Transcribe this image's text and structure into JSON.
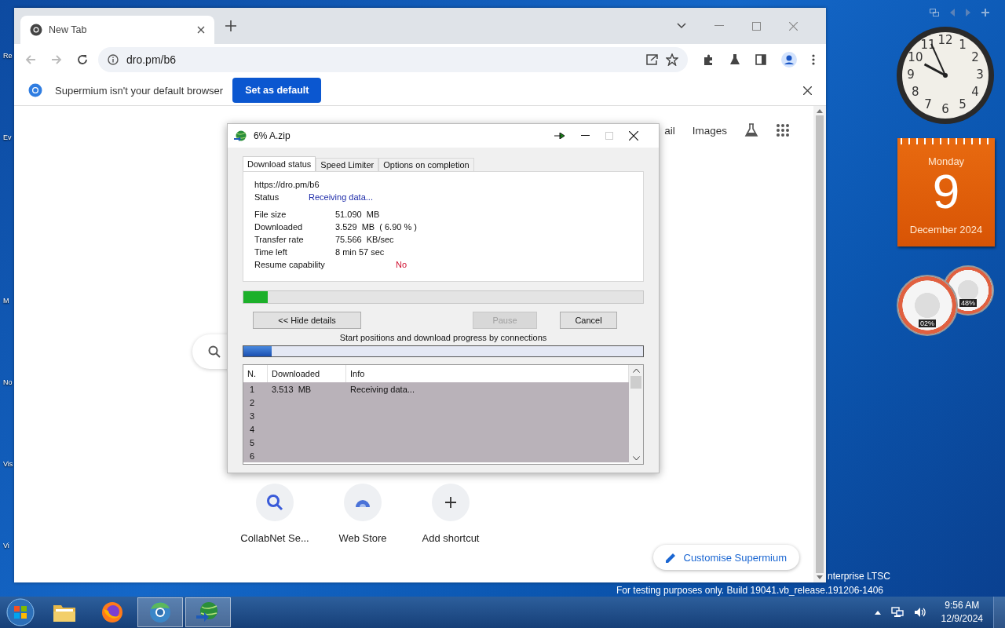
{
  "desktop": {
    "icon_labels": [
      "Re",
      "Ev",
      "M",
      "No",
      "Vis",
      "Vi"
    ],
    "watermark": [
      "nterprise LTSC",
      "For testing purposes only. Build 19041.vb_release.191206-1406"
    ]
  },
  "browser": {
    "tabs": [
      {
        "title": "New Tab",
        "selected": true
      }
    ],
    "address": "dro.pm/b6",
    "infobar": {
      "message": "Supermium isn't your default browser",
      "button": "Set as default"
    },
    "page": {
      "top_links": [
        "ail",
        "Images"
      ],
      "shortcuts": [
        {
          "label": "CollabNet Se...",
          "kind": "search"
        },
        {
          "label": "Web Store",
          "kind": "store"
        },
        {
          "label": "Add shortcut",
          "kind": "add"
        }
      ],
      "customise": "Customise Supermium"
    }
  },
  "download_dialog": {
    "title": "6% A.zip",
    "tabs": [
      {
        "label": "Download status",
        "selected": true
      },
      {
        "label": "Speed Limiter",
        "selected": false
      },
      {
        "label": "Options on completion",
        "selected": false
      }
    ],
    "url": "https://dro.pm/b6",
    "status": {
      "label": "Status",
      "value": "Receiving data..."
    },
    "details": [
      {
        "label": "File size",
        "value": "51.090  MB"
      },
      {
        "label": "Downloaded",
        "value": "3.529  MB  ( 6.90 % )"
      },
      {
        "label": "Transfer rate",
        "value": "75.566  KB/sec"
      },
      {
        "label": "Time left",
        "value": "8 min 57 sec"
      }
    ],
    "resume": {
      "label": "Resume capability",
      "value": "No"
    },
    "level": 0.06,
    "buttons": [
      {
        "label": "<< Hide details",
        "disabled": false
      },
      {
        "label": "Pause",
        "disabled": true
      },
      {
        "label": "Cancel",
        "disabled": false
      }
    ],
    "connections": {
      "caption": "Start positions and download progress by connections",
      "level": 0.07
    },
    "table": {
      "columns": [
        "N.",
        "Downloaded",
        "Info"
      ],
      "rows": [
        {
          "n": "1",
          "downloaded": "3.513  MB",
          "info": "Receiving data..."
        },
        {
          "n": "2"
        },
        {
          "n": "3"
        },
        {
          "n": "4"
        },
        {
          "n": "5"
        },
        {
          "n": "6"
        }
      ]
    }
  },
  "gadgets": {
    "clock": {
      "numerals": [
        "11",
        "12",
        "1",
        "10",
        "2",
        "9",
        "3",
        "8",
        "4",
        "7",
        "6",
        "5"
      ]
    },
    "calendar": {
      "weekday": "Monday",
      "day": "9",
      "month_year": "December 2024"
    },
    "meters": [
      "02%",
      "48%"
    ]
  },
  "taskbar": {
    "apps": [
      {
        "kind": "folder",
        "active": false
      },
      {
        "kind": "firefox",
        "active": false
      },
      {
        "kind": "browser",
        "active": true
      },
      {
        "kind": "download",
        "active": true
      }
    ],
    "time": "9:56 AM",
    "date": "12/9/2024"
  }
}
